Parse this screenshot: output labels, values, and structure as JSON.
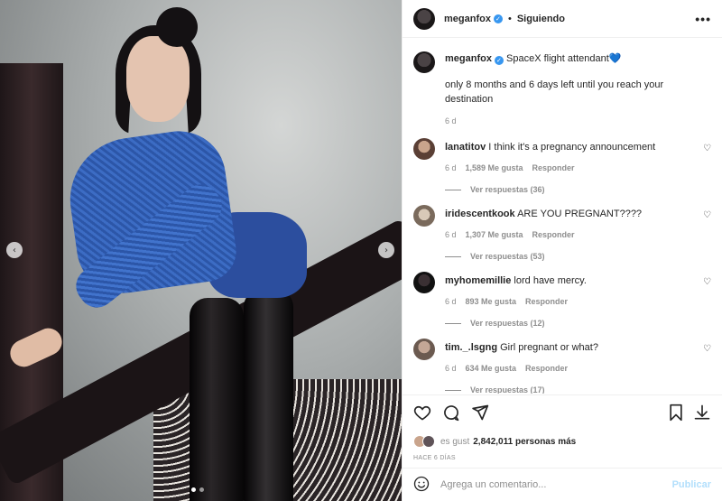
{
  "header": {
    "username": "meganfox",
    "separator": "•",
    "follow_status": "Siguiendo",
    "more_icon": "ellipsis"
  },
  "caption": {
    "username": "meganfox",
    "text": "SpaceX flight attendant",
    "emoji": "💙",
    "line2": "only 8 months and 6 days left until you reach your destination",
    "time": "6 d"
  },
  "comments": [
    {
      "username": "lanatitov",
      "text": "I think it's a pregnancy announcement",
      "time": "6 d",
      "likes": "1,589 Me gusta",
      "reply": "Responder",
      "view_replies": "Ver respuestas (36)"
    },
    {
      "username": "iridescentkook",
      "text": "ARE YOU PREGNANT????",
      "time": "6 d",
      "likes": "1,307 Me gusta",
      "reply": "Responder",
      "view_replies": "Ver respuestas (53)"
    },
    {
      "username": "myhomemillie",
      "text": "lord have mercy.",
      "time": "6 d",
      "likes": "893 Me gusta",
      "reply": "Responder",
      "view_replies": "Ver respuestas (12)"
    },
    {
      "username": "tim._.lsgng",
      "text": "Girl pregnant or what?",
      "time": "6 d",
      "likes": "634 Me gusta",
      "reply": "Responder",
      "view_replies": "Ver respuestas (17)"
    }
  ],
  "actions": {
    "icons": [
      "heart-icon",
      "comment-icon",
      "share-icon",
      "bookmark-icon",
      "download-icon"
    ]
  },
  "likes": {
    "prefix": "es gust",
    "count_text": "2,842,011 personas más"
  },
  "post_date": "HACE 6 DÍAS",
  "add_comment": {
    "placeholder": "Agrega un comentario...",
    "publish": "Publicar"
  },
  "carousel": {
    "total": 2,
    "active": 1,
    "prev_glyph": "‹",
    "next_glyph": "›"
  },
  "colors": {
    "verified": "#3897f0",
    "publish_disabled": "#b2dffc",
    "muted": "#8e8e8e"
  }
}
